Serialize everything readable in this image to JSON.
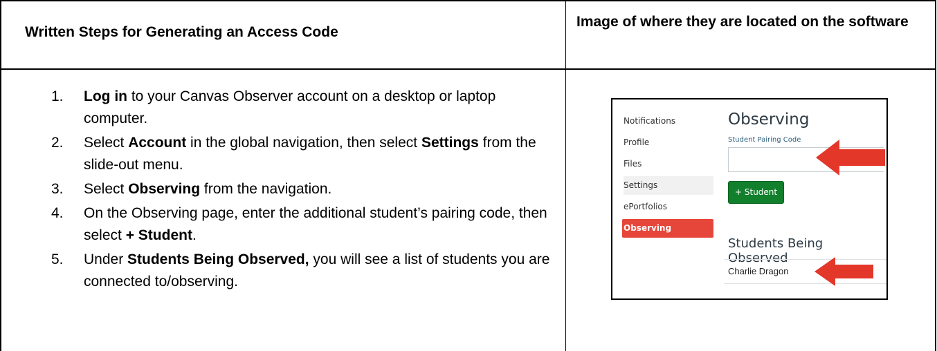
{
  "header": {
    "left": "Written Steps for Generating an Access Code",
    "right": "Image of where they are located on the software"
  },
  "steps": [
    {
      "num": "1.",
      "parts": [
        {
          "b": true,
          "t": "Log in"
        },
        {
          "b": false,
          "t": " to your Canvas Observer account on a desktop or laptop computer."
        }
      ]
    },
    {
      "num": "2.",
      "parts": [
        {
          "b": false,
          "t": "Select "
        },
        {
          "b": true,
          "t": "Account"
        },
        {
          "b": false,
          "t": " in the global navigation, then select "
        },
        {
          "b": true,
          "t": "Settings"
        },
        {
          "b": false,
          "t": " from the slide-out menu."
        }
      ]
    },
    {
      "num": "3.",
      "parts": [
        {
          "b": false,
          "t": "Select "
        },
        {
          "b": true,
          "t": "Observing"
        },
        {
          "b": false,
          "t": " from the navigation."
        }
      ]
    },
    {
      "num": "4.",
      "parts": [
        {
          "b": false,
          "t": "On the Observing page, enter the additional student’s pairing code, then select "
        },
        {
          "b": true,
          "t": "+ Student"
        },
        {
          "b": false,
          "t": "."
        }
      ]
    },
    {
      "num": "5.",
      "parts": [
        {
          "b": false,
          "t": "Under "
        },
        {
          "b": true,
          "t": "Students Being Observed,"
        },
        {
          "b": false,
          "t": " you will see a list of students you are connected to/observing."
        }
      ]
    }
  ],
  "screenshot": {
    "nav": [
      "Notifications",
      "Profile",
      "Files",
      "Settings",
      "ePortfolios",
      "Observing"
    ],
    "active_nav": "Observing",
    "title": "Observing",
    "pairing_label": "Student Pairing Code",
    "add_button": "+ Student",
    "observed_title": "Students Being Observed",
    "observed_students": [
      "Charlie Dragon"
    ],
    "colors": {
      "active_nav": "#e6463a",
      "button": "#127f2c",
      "arrow": "#e3372a"
    }
  }
}
